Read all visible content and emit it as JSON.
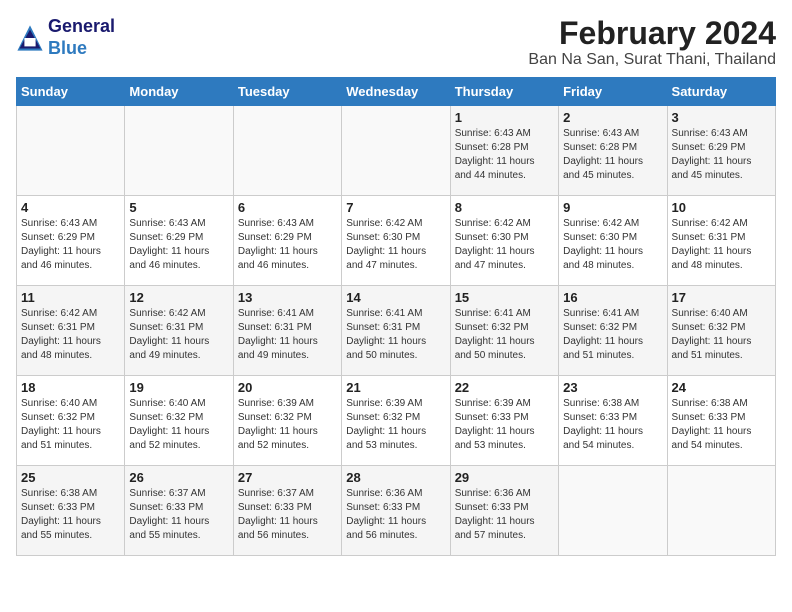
{
  "header": {
    "logo_general": "General",
    "logo_blue": "Blue",
    "month": "February 2024",
    "location": "Ban Na San, Surat Thani, Thailand"
  },
  "days_of_week": [
    "Sunday",
    "Monday",
    "Tuesday",
    "Wednesday",
    "Thursday",
    "Friday",
    "Saturday"
  ],
  "weeks": [
    [
      {
        "num": "",
        "detail": ""
      },
      {
        "num": "",
        "detail": ""
      },
      {
        "num": "",
        "detail": ""
      },
      {
        "num": "",
        "detail": ""
      },
      {
        "num": "1",
        "detail": "Sunrise: 6:43 AM\nSunset: 6:28 PM\nDaylight: 11 hours\nand 44 minutes."
      },
      {
        "num": "2",
        "detail": "Sunrise: 6:43 AM\nSunset: 6:28 PM\nDaylight: 11 hours\nand 45 minutes."
      },
      {
        "num": "3",
        "detail": "Sunrise: 6:43 AM\nSunset: 6:29 PM\nDaylight: 11 hours\nand 45 minutes."
      }
    ],
    [
      {
        "num": "4",
        "detail": "Sunrise: 6:43 AM\nSunset: 6:29 PM\nDaylight: 11 hours\nand 46 minutes."
      },
      {
        "num": "5",
        "detail": "Sunrise: 6:43 AM\nSunset: 6:29 PM\nDaylight: 11 hours\nand 46 minutes."
      },
      {
        "num": "6",
        "detail": "Sunrise: 6:43 AM\nSunset: 6:29 PM\nDaylight: 11 hours\nand 46 minutes."
      },
      {
        "num": "7",
        "detail": "Sunrise: 6:42 AM\nSunset: 6:30 PM\nDaylight: 11 hours\nand 47 minutes."
      },
      {
        "num": "8",
        "detail": "Sunrise: 6:42 AM\nSunset: 6:30 PM\nDaylight: 11 hours\nand 47 minutes."
      },
      {
        "num": "9",
        "detail": "Sunrise: 6:42 AM\nSunset: 6:30 PM\nDaylight: 11 hours\nand 48 minutes."
      },
      {
        "num": "10",
        "detail": "Sunrise: 6:42 AM\nSunset: 6:31 PM\nDaylight: 11 hours\nand 48 minutes."
      }
    ],
    [
      {
        "num": "11",
        "detail": "Sunrise: 6:42 AM\nSunset: 6:31 PM\nDaylight: 11 hours\nand 48 minutes."
      },
      {
        "num": "12",
        "detail": "Sunrise: 6:42 AM\nSunset: 6:31 PM\nDaylight: 11 hours\nand 49 minutes."
      },
      {
        "num": "13",
        "detail": "Sunrise: 6:41 AM\nSunset: 6:31 PM\nDaylight: 11 hours\nand 49 minutes."
      },
      {
        "num": "14",
        "detail": "Sunrise: 6:41 AM\nSunset: 6:31 PM\nDaylight: 11 hours\nand 50 minutes."
      },
      {
        "num": "15",
        "detail": "Sunrise: 6:41 AM\nSunset: 6:32 PM\nDaylight: 11 hours\nand 50 minutes."
      },
      {
        "num": "16",
        "detail": "Sunrise: 6:41 AM\nSunset: 6:32 PM\nDaylight: 11 hours\nand 51 minutes."
      },
      {
        "num": "17",
        "detail": "Sunrise: 6:40 AM\nSunset: 6:32 PM\nDaylight: 11 hours\nand 51 minutes."
      }
    ],
    [
      {
        "num": "18",
        "detail": "Sunrise: 6:40 AM\nSunset: 6:32 PM\nDaylight: 11 hours\nand 51 minutes."
      },
      {
        "num": "19",
        "detail": "Sunrise: 6:40 AM\nSunset: 6:32 PM\nDaylight: 11 hours\nand 52 minutes."
      },
      {
        "num": "20",
        "detail": "Sunrise: 6:39 AM\nSunset: 6:32 PM\nDaylight: 11 hours\nand 52 minutes."
      },
      {
        "num": "21",
        "detail": "Sunrise: 6:39 AM\nSunset: 6:32 PM\nDaylight: 11 hours\nand 53 minutes."
      },
      {
        "num": "22",
        "detail": "Sunrise: 6:39 AM\nSunset: 6:33 PM\nDaylight: 11 hours\nand 53 minutes."
      },
      {
        "num": "23",
        "detail": "Sunrise: 6:38 AM\nSunset: 6:33 PM\nDaylight: 11 hours\nand 54 minutes."
      },
      {
        "num": "24",
        "detail": "Sunrise: 6:38 AM\nSunset: 6:33 PM\nDaylight: 11 hours\nand 54 minutes."
      }
    ],
    [
      {
        "num": "25",
        "detail": "Sunrise: 6:38 AM\nSunset: 6:33 PM\nDaylight: 11 hours\nand 55 minutes."
      },
      {
        "num": "26",
        "detail": "Sunrise: 6:37 AM\nSunset: 6:33 PM\nDaylight: 11 hours\nand 55 minutes."
      },
      {
        "num": "27",
        "detail": "Sunrise: 6:37 AM\nSunset: 6:33 PM\nDaylight: 11 hours\nand 56 minutes."
      },
      {
        "num": "28",
        "detail": "Sunrise: 6:36 AM\nSunset: 6:33 PM\nDaylight: 11 hours\nand 56 minutes."
      },
      {
        "num": "29",
        "detail": "Sunrise: 6:36 AM\nSunset: 6:33 PM\nDaylight: 11 hours\nand 57 minutes."
      },
      {
        "num": "",
        "detail": ""
      },
      {
        "num": "",
        "detail": ""
      }
    ]
  ]
}
